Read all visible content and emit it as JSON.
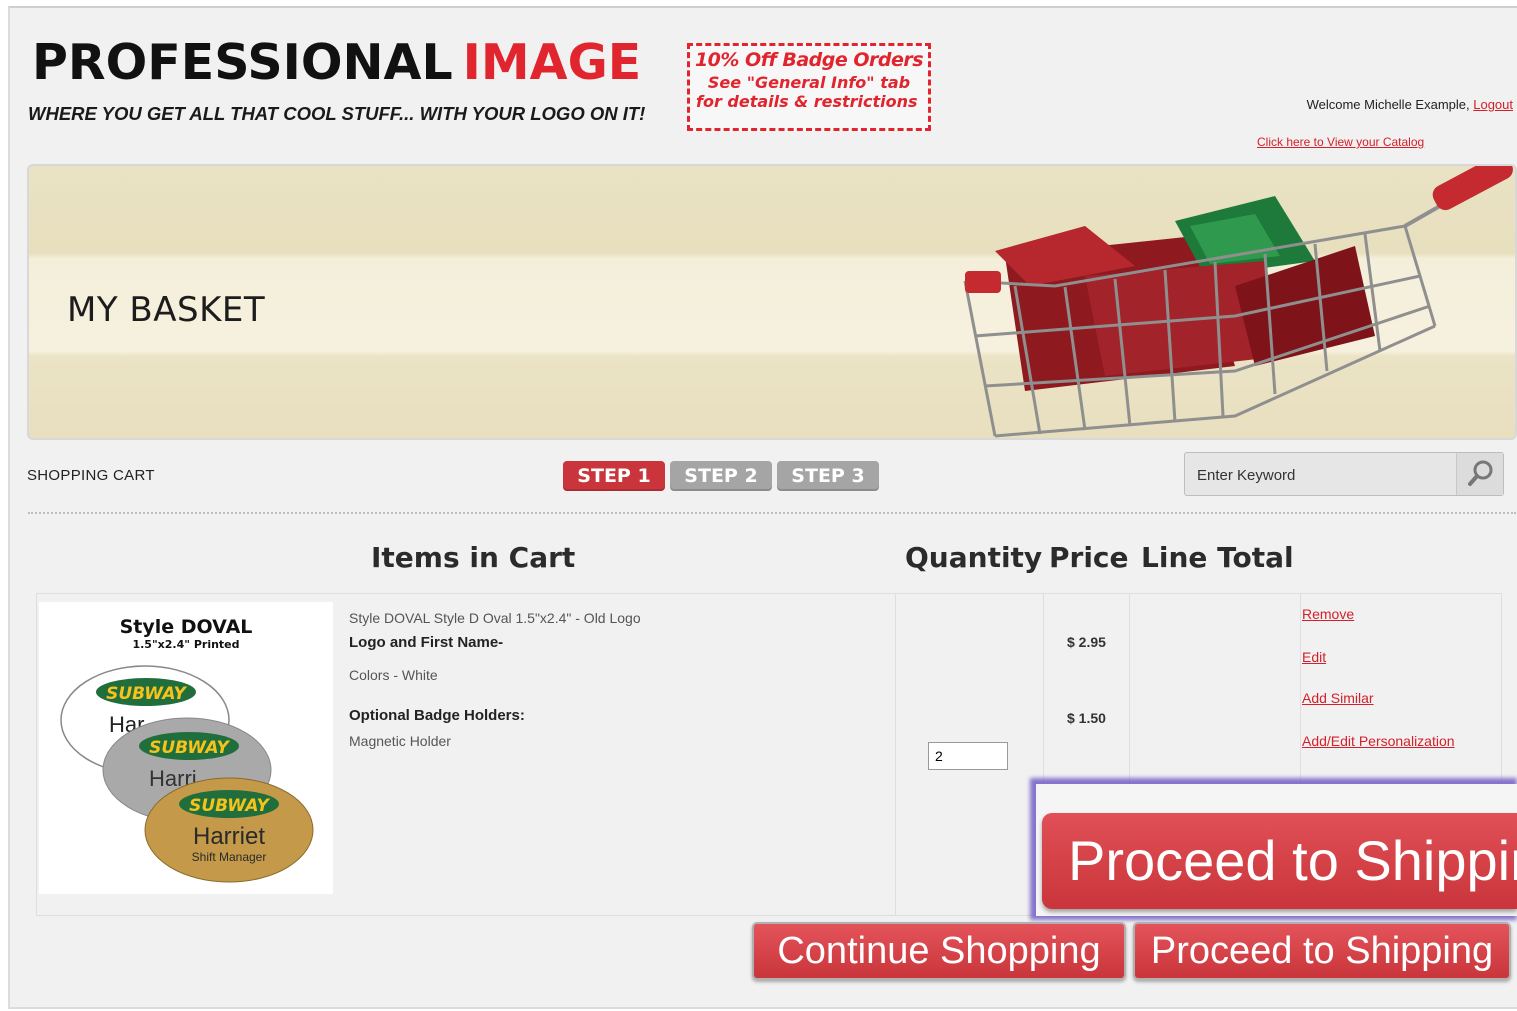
{
  "header": {
    "brand_black": "PROFESSIONAL",
    "brand_red": "IMAGE",
    "tagline": "WHERE YOU GET ALL THAT COOL STUFF... WITH YOUR LOGO ON IT!",
    "promo_line1": "10% Off Badge Orders",
    "promo_line2": "See \"General Info\" tab",
    "promo_line3": "for details & restrictions",
    "welcome_text": "Welcome Michelle Example,",
    "logout_label": "Logout",
    "catalog_link": "Click here to View your Catalog"
  },
  "banner": {
    "title": "MY BASKET"
  },
  "toolbar": {
    "breadcrumb": "SHOPPING CART",
    "steps": [
      "STEP 1",
      "STEP 2",
      "STEP 3"
    ],
    "search_placeholder": "Enter Keyword"
  },
  "cart": {
    "headers": {
      "items": "Items in Cart",
      "quantity": "Quantity",
      "price": "Price",
      "line_total": "Line Total"
    },
    "item": {
      "thumb_title": "Style DOVAL",
      "thumb_sub": "1.5\"x2.4\" Printed",
      "badge_brand": "SUBWAY",
      "badge_name": "Harriet",
      "badge_role": "Shift Manager",
      "name": "Style DOVAL Style D Oval 1.5\"x2.4\" - Old Logo",
      "option_label": "Logo and First Name-",
      "colors": "Colors - White",
      "holders_label": "Optional Badge Holders:",
      "holder_value": "Magnetic Holder",
      "price_main": "$ 2.95",
      "price_holder": "$ 1.50",
      "quantity": "2",
      "actions": [
        "Remove",
        "Edit",
        "Add Similar",
        "Add/Edit Personalization"
      ]
    }
  },
  "buttons": {
    "continue": "Continue Shopping",
    "proceed": "Proceed to Shipping",
    "proceed_zoom": "Proceed to Shipping"
  },
  "colors": {
    "accent_red": "#e0252f",
    "button_red": "#c9353b",
    "step_inactive": "#a5a5a5",
    "zoom_highlight": "#7a66c9"
  }
}
